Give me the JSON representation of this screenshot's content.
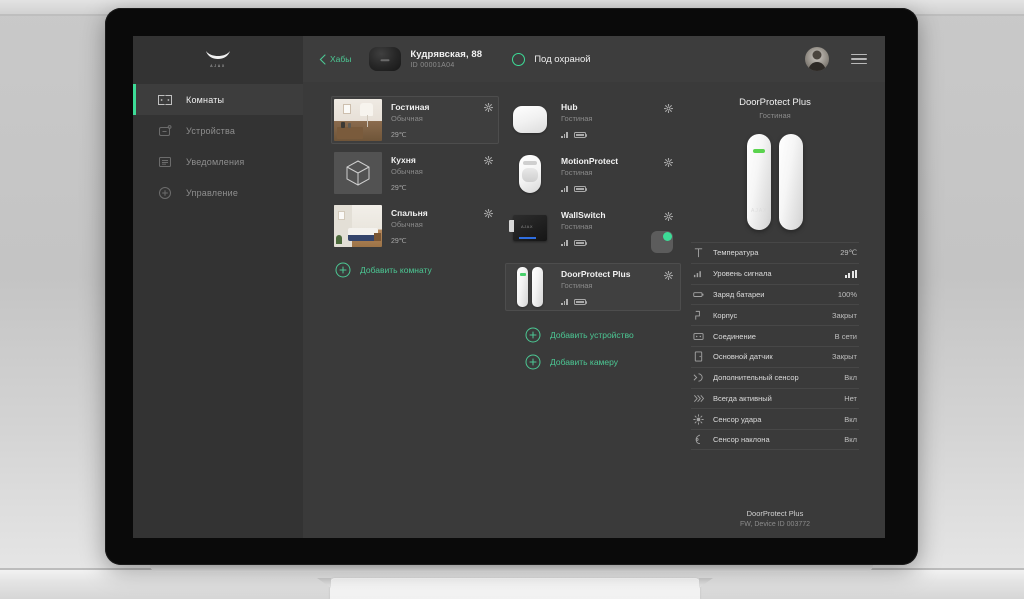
{
  "sidebar": {
    "brand": {
      "wordmark": "AJAX"
    },
    "items": [
      {
        "label": "Комнаты",
        "icon": "rooms-icon",
        "active": true
      },
      {
        "label": "Устройства",
        "icon": "devices-icon",
        "active": false
      },
      {
        "label": "Уведомления",
        "icon": "notifications-icon",
        "active": false
      },
      {
        "label": "Управление",
        "icon": "control-icon",
        "active": false
      }
    ]
  },
  "topbar": {
    "back_label": "Хабы",
    "hub_name": "Кудрявская, 88",
    "hub_id": "ID 00001A04",
    "status_label": "Под охраной",
    "status_color": "#3ddc97",
    "avatar": "user-avatar",
    "menu": "hamburger-menu-icon"
  },
  "rooms": {
    "items": [
      {
        "name": "Гостиная",
        "type": "Обычная",
        "temp": "29℃",
        "selected": true,
        "art": "living-room"
      },
      {
        "name": "Кухня",
        "type": "Обычная",
        "temp": "29℃",
        "selected": false,
        "art": "placeholder-cube"
      },
      {
        "name": "Спальня",
        "type": "Обычная",
        "temp": "29℃",
        "selected": false,
        "art": "bedroom"
      }
    ],
    "add_label": "Добавить комнату"
  },
  "devices": {
    "items": [
      {
        "name": "Hub",
        "room": "Гостиная",
        "selected": false,
        "toggle": null,
        "art": "hub"
      },
      {
        "name": "MotionProtect",
        "room": "Гостиная",
        "selected": false,
        "toggle": null,
        "art": "motion"
      },
      {
        "name": "WallSwitch",
        "room": "Гостиная",
        "selected": false,
        "toggle": "on",
        "art": "wallswitch"
      },
      {
        "name": "DoorProtect Plus",
        "room": "Гостиная",
        "selected": true,
        "toggle": null,
        "art": "doorprotect"
      }
    ],
    "add_device_label": "Добавить устройство",
    "add_camera_label": "Добавить камеру"
  },
  "detail": {
    "title": "DoorProtect Plus",
    "subtitle": "Гостиная",
    "properties": [
      {
        "icon": "temperature-icon",
        "name": "Температура",
        "value": "29℃"
      },
      {
        "icon": "signal-icon",
        "name": "Уровень сигнала",
        "value": "",
        "render": "signal-bars"
      },
      {
        "icon": "battery-icon",
        "name": "Заряд батареи",
        "value": "100%"
      },
      {
        "icon": "tamper-icon",
        "name": "Корпус",
        "value": "Закрыт"
      },
      {
        "icon": "connection-icon",
        "name": "Соединение",
        "value": "В сети"
      },
      {
        "icon": "door-sensor-icon",
        "name": "Основной датчик",
        "value": "Закрыт"
      },
      {
        "icon": "aux-sensor-icon",
        "name": "Дополнительный сенсор",
        "value": "Вкл"
      },
      {
        "icon": "always-active-icon",
        "name": "Всегда активный",
        "value": "Нет"
      },
      {
        "icon": "shock-sensor-icon",
        "name": "Сенсор удара",
        "value": "Вкл"
      },
      {
        "icon": "tilt-sensor-icon",
        "name": "Сенсор наклона",
        "value": "Вкл"
      }
    ],
    "footer_name": "DoorProtect Plus",
    "footer_fw": "FW, Device ID 003772"
  }
}
